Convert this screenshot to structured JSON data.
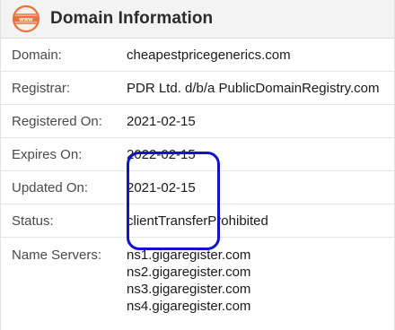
{
  "header": {
    "title": "Domain Information",
    "icon": "www-globe-icon",
    "icon_text": "www",
    "icon_color": "#e8743b"
  },
  "rows": [
    {
      "label": "Domain:",
      "value": "cheapestpricegenerics.com"
    },
    {
      "label": "Registrar:",
      "value": "PDR Ltd. d/b/a PublicDomainRegistry.com"
    },
    {
      "label": "Registered On:",
      "value": "2021-02-15"
    },
    {
      "label": "Expires On:",
      "value": "2022-02-15"
    },
    {
      "label": "Updated On:",
      "value": "2021-02-15"
    },
    {
      "label": "Status:",
      "value": "clientTransferProhibited"
    }
  ],
  "name_servers": {
    "label": "Name Servers:",
    "values": [
      "ns1.gigaregister.com",
      "ns2.gigaregister.com",
      "ns3.gigaregister.com",
      "ns4.gigaregister.com"
    ]
  },
  "annotation": {
    "color": "#1212cc"
  }
}
